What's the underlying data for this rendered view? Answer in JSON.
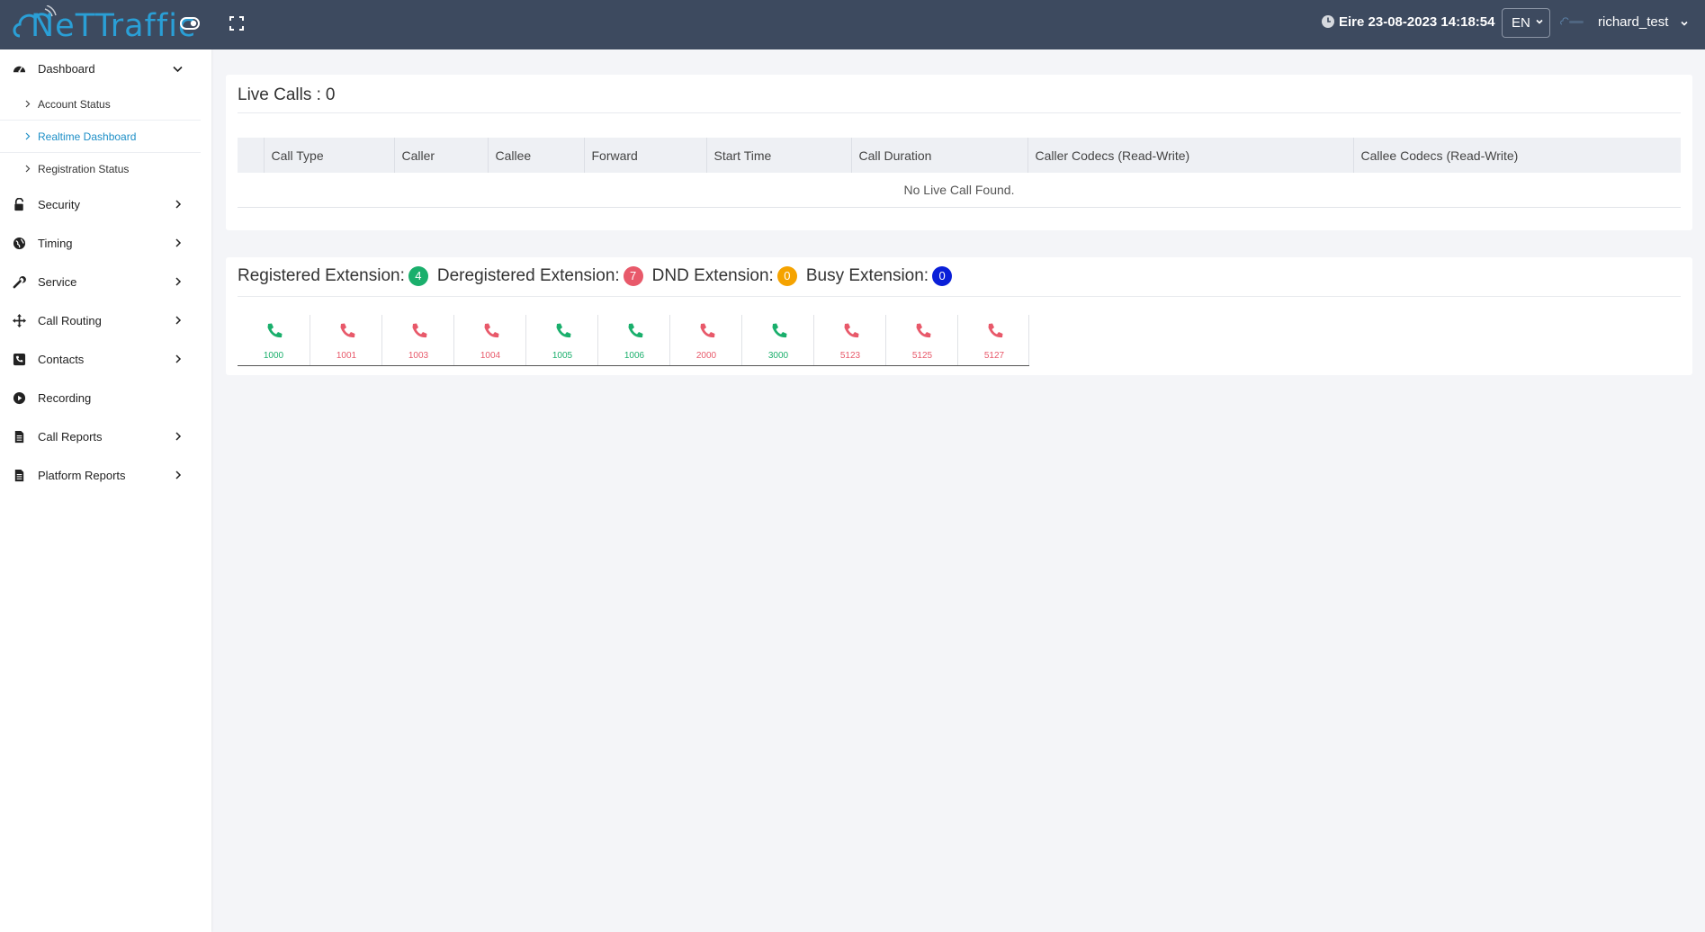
{
  "header": {
    "logo_text": "NeTTraffic",
    "datetime": "Eire 23-08-2023 14:18:54",
    "language": "EN",
    "username": "richard_test"
  },
  "sidebar": {
    "items": [
      {
        "label": "Dashboard",
        "icon": "dashboard-icon",
        "open": true
      },
      {
        "label": "Security",
        "icon": "lock-icon"
      },
      {
        "label": "Timing",
        "icon": "globe-icon"
      },
      {
        "label": "Service",
        "icon": "wrench-icon"
      },
      {
        "label": "Call Routing",
        "icon": "arrows-icon"
      },
      {
        "label": "Contacts",
        "icon": "phone-book-icon"
      },
      {
        "label": "Recording",
        "icon": "play-circle-icon"
      },
      {
        "label": "Call Reports",
        "icon": "document-icon"
      },
      {
        "label": "Platform Reports",
        "icon": "document-icon"
      }
    ],
    "dashboard_sub": [
      {
        "label": "Account Status"
      },
      {
        "label": "Realtime Dashboard",
        "active": true
      },
      {
        "label": "Registration Status"
      }
    ]
  },
  "live_calls": {
    "title": "Live Calls : ",
    "count": "0",
    "columns": [
      "Call Type",
      "Caller",
      "Callee",
      "Forward",
      "Start Time",
      "Call Duration",
      "Caller Codecs (Read-Write)",
      "Callee Codecs (Read-Write)"
    ],
    "empty_message": "No Live Call Found."
  },
  "extensions": {
    "registered_label": "Registered Extension:",
    "registered_count": "4",
    "deregistered_label": "Deregistered Extension:",
    "deregistered_count": "7",
    "dnd_label": "DND Extension:",
    "dnd_count": "0",
    "busy_label": "Busy Extension:",
    "busy_count": "0",
    "items": [
      {
        "number": "1000",
        "status": "registered"
      },
      {
        "number": "1001",
        "status": "deregistered"
      },
      {
        "number": "1003",
        "status": "deregistered"
      },
      {
        "number": "1004",
        "status": "deregistered"
      },
      {
        "number": "1005",
        "status": "registered"
      },
      {
        "number": "1006",
        "status": "registered"
      },
      {
        "number": "2000",
        "status": "deregistered"
      },
      {
        "number": "3000",
        "status": "registered"
      },
      {
        "number": "5123",
        "status": "deregistered"
      },
      {
        "number": "5125",
        "status": "deregistered"
      },
      {
        "number": "5127",
        "status": "deregistered"
      }
    ]
  },
  "colors": {
    "header_bg": "#3d4a5f",
    "accent": "#1d8fc7",
    "registered": "#1aaf6c",
    "deregistered": "#e8596a",
    "dnd": "#f5a300",
    "busy": "#0a1fd8"
  }
}
